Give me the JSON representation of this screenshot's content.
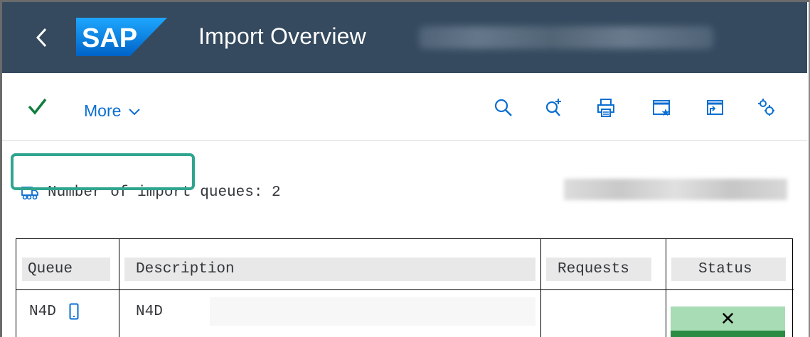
{
  "shell": {
    "logo_text": "SAP",
    "title": "Import Overview"
  },
  "toolbar": {
    "more_label": "More",
    "icons": [
      "check-icon",
      "search-icon",
      "search-next-icon",
      "print-icon",
      "new-session-icon",
      "open-window-icon",
      "settings-icon"
    ]
  },
  "content": {
    "queue_count_label": "Number of import queues: 2"
  },
  "table": {
    "headers": {
      "queue": "Queue",
      "description": "Description",
      "requests": "Requests",
      "status": "Status"
    },
    "rows": [
      {
        "queue": "N4D",
        "description": "N4D",
        "requests": "",
        "status_symbol": "✕"
      }
    ]
  },
  "colors": {
    "shell_bg": "#354a5f",
    "accent": "#0a6ed1",
    "highlight": "#2fa58f",
    "status_green": "#a8dcb4"
  }
}
